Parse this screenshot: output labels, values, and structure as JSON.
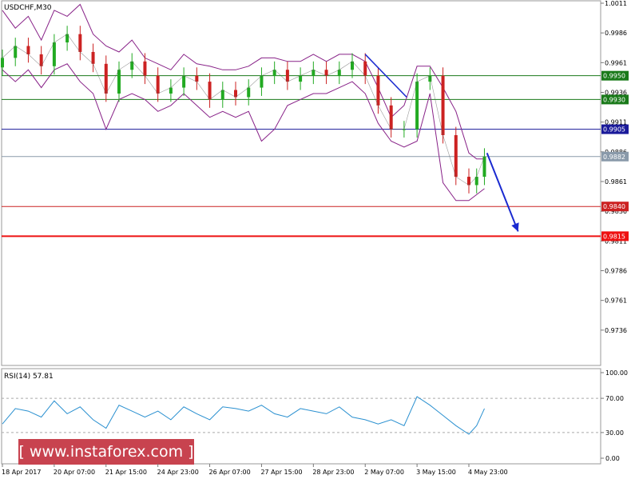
{
  "chart_data": [
    {
      "type": "line",
      "title": "USDCHF,M30",
      "symbol": "USDCHF",
      "timeframe": "M30",
      "indicators": [
        "candlesticks",
        "bollinger-bands"
      ],
      "ylim": [
        0.9711,
        1.0011
      ],
      "yticks": [
        1.0011,
        0.9986,
        0.9961,
        0.9936,
        0.9911,
        0.9886,
        0.9861,
        0.9836,
        0.9811,
        0.9786,
        0.9761,
        0.9736
      ],
      "xticks": [
        "18 Apr 2017",
        "20 Apr 07:00",
        "21 Apr 15:00",
        "24 Apr 23:00",
        "26 Apr 07:00",
        "27 Apr 15:00",
        "28 Apr 23:00",
        "2 May 07:00",
        "3 May 15:00",
        "4 May 23:00"
      ],
      "xtick_index": [
        0,
        1,
        2,
        3,
        4,
        5,
        6,
        7,
        8,
        9
      ],
      "x_index_range": [
        0,
        11.7
      ],
      "price": {
        "x_index": [
          0,
          0.25,
          0.5,
          0.75,
          1.0,
          1.25,
          1.5,
          1.75,
          2.0,
          2.25,
          2.5,
          2.75,
          3.0,
          3.25,
          3.5,
          3.75,
          4.0,
          4.25,
          4.5,
          4.75,
          5.0,
          5.25,
          5.5,
          5.75,
          6.0,
          6.25,
          6.5,
          6.75,
          7.0,
          7.25,
          7.5,
          7.75,
          8.0,
          8.25,
          8.5,
          8.75,
          9.0,
          9.15,
          9.3
        ],
        "values": [
          0.9965,
          0.9975,
          0.9968,
          0.9958,
          0.9978,
          0.9985,
          0.997,
          0.996,
          0.9935,
          0.9955,
          0.9962,
          0.995,
          0.9935,
          0.994,
          0.995,
          0.9945,
          0.993,
          0.9938,
          0.9932,
          0.994,
          0.995,
          0.9955,
          0.9945,
          0.995,
          0.9955,
          0.995,
          0.9955,
          0.9962,
          0.995,
          0.9925,
          0.9905,
          0.9905,
          0.9945,
          0.995,
          0.99,
          0.9865,
          0.9858,
          0.9865,
          0.9882
        ]
      },
      "bb_upper": [
        1.0005,
        0.999,
        1.0,
        0.998,
        1.0005,
        1.0,
        1.001,
        0.9985,
        0.9975,
        0.997,
        0.998,
        0.9965,
        0.996,
        0.9955,
        0.9968,
        0.996,
        0.9958,
        0.9955,
        0.9955,
        0.9958,
        0.9965,
        0.9965,
        0.9962,
        0.9962,
        0.9968,
        0.9962,
        0.9968,
        0.9968,
        0.9962,
        0.994,
        0.9915,
        0.9925,
        0.9958,
        0.9958,
        0.994,
        0.992,
        0.9885,
        0.988,
        0.988
      ],
      "bb_lower": [
        0.9955,
        0.9945,
        0.9955,
        0.994,
        0.9955,
        0.996,
        0.9945,
        0.9935,
        0.9905,
        0.993,
        0.9935,
        0.993,
        0.992,
        0.9925,
        0.9935,
        0.9925,
        0.9915,
        0.992,
        0.9915,
        0.992,
        0.9895,
        0.9905,
        0.9925,
        0.993,
        0.9935,
        0.9935,
        0.994,
        0.9945,
        0.9935,
        0.991,
        0.9895,
        0.989,
        0.9895,
        0.9935,
        0.986,
        0.9845,
        0.9845,
        0.985,
        0.9855
      ],
      "levels": [
        {
          "label": "0.9950",
          "value": 0.995,
          "color": "#1a7a1a"
        },
        {
          "label": "0.9930",
          "value": 0.993,
          "color": "#1a7a1a"
        },
        {
          "label": "0.9905",
          "value": 0.9905,
          "color": "#1a1a9a"
        },
        {
          "label": "0.9882",
          "value": 0.9882,
          "color": "#8a9aaa"
        },
        {
          "label": "0.9840",
          "value": 0.984,
          "color": "#cc2222"
        },
        {
          "label": "0.9815",
          "value": 0.9815,
          "color": "#ee1111"
        }
      ],
      "trendline": {
        "x_index": [
          7.0,
          7.8
        ],
        "values": [
          0.9968,
          0.9932
        ]
      },
      "arrow": {
        "x_index": [
          9.35,
          9.95
        ],
        "values": [
          0.9885,
          0.9819
        ]
      },
      "colors": {
        "up_candle": "#22aa22",
        "down_candle": "#cc2222",
        "bands": "#882288",
        "trendline": "#1a2ad0",
        "grid": "#d8d8d8"
      }
    },
    {
      "type": "line",
      "title": "RSI(14) 57.81",
      "ylim": [
        0,
        100
      ],
      "yticks": [
        "100.00",
        "70.00",
        "30.00",
        "0.00"
      ],
      "ytick_values": [
        100,
        70,
        30,
        0
      ],
      "dashed_levels": [
        70,
        30
      ],
      "series": [
        {
          "x_index": [
            0,
            0.25,
            0.5,
            0.75,
            1.0,
            1.25,
            1.5,
            1.75,
            2.0,
            2.25,
            2.5,
            2.75,
            3.0,
            3.25,
            3.5,
            3.75,
            4.0,
            4.25,
            4.5,
            4.75,
            5.0,
            5.25,
            5.5,
            5.75,
            6.0,
            6.25,
            6.5,
            6.75,
            7.0,
            7.25,
            7.5,
            7.75,
            8.0,
            8.25,
            8.5,
            8.75,
            9.0,
            9.15,
            9.3
          ],
          "values": [
            40,
            58,
            55,
            48,
            67,
            52,
            60,
            45,
            35,
            62,
            55,
            48,
            55,
            45,
            60,
            52,
            45,
            60,
            58,
            55,
            62,
            52,
            48,
            58,
            55,
            52,
            60,
            48,
            45,
            40,
            45,
            38,
            72,
            62,
            50,
            38,
            28,
            38,
            58
          ]
        }
      ],
      "colors": {
        "line": "#2a90d0",
        "level": "#aaaaaa"
      }
    }
  ],
  "watermark": {
    "text": "[  www.instaforex.com  ]",
    "background": "#c8434f"
  }
}
